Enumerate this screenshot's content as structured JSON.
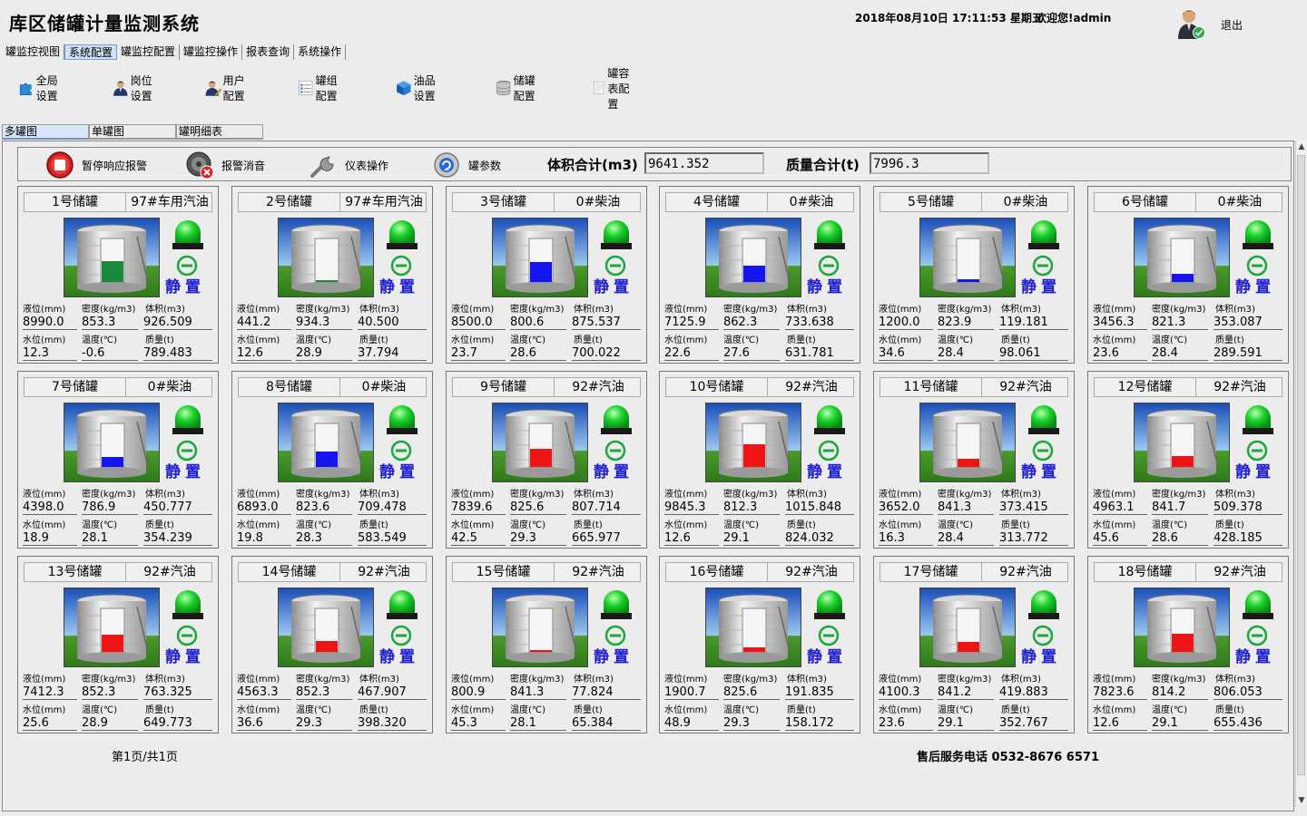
{
  "app": {
    "title": "库区储罐计量监测系统",
    "datetime": "2018年08月10日 17:11:53 星期五",
    "welcome": "欢迎您!admin",
    "logout": "退出"
  },
  "menu": [
    {
      "label": "罐监控视图",
      "active": false
    },
    {
      "label": "系统配置",
      "active": true
    },
    {
      "label": "罐监控配置",
      "active": false
    },
    {
      "label": "罐监控操作",
      "active": false
    },
    {
      "label": "报表查询",
      "active": false
    },
    {
      "label": "系统操作",
      "active": false
    }
  ],
  "toolbar": [
    {
      "label": "全局设置",
      "icon": "puzzle-icon"
    },
    {
      "label": "岗位设置",
      "icon": "person-icon"
    },
    {
      "label": "用户配置",
      "icon": "user-edit-icon"
    },
    {
      "label": "罐组配置",
      "icon": "list-icon"
    },
    {
      "label": "油品设置",
      "icon": "cube-icon"
    },
    {
      "label": "储罐配置",
      "icon": "database-icon"
    },
    {
      "label": "罐容表配置",
      "icon": "document-icon"
    }
  ],
  "view_tabs": [
    {
      "label": "多罐图",
      "active": true
    },
    {
      "label": "单罐图",
      "active": false
    },
    {
      "label": "罐明细表",
      "active": false
    }
  ],
  "actions": {
    "pause_alarm": "暂停响应报警",
    "mute_alarm": "报警消音",
    "instrument": "仪表操作",
    "tank_params": "罐参数",
    "volume_total_label": "体积合计(m3)",
    "volume_total": "9641.352",
    "mass_total_label": "质量合计(t)",
    "mass_total": "7996.3"
  },
  "labels": {
    "level": "液位(mm)",
    "density": "密度(kg/m3)",
    "volume": "体积(m3)",
    "water": "水位(mm)",
    "temperature": "温度(℃)",
    "mass": "质量(t)"
  },
  "tanks": [
    {
      "name": "1号储罐",
      "oil": "97#车用汽油",
      "state": "静置",
      "level": "8990.0",
      "density": "853.3",
      "volume": "926.509",
      "water": "12.3",
      "temperature": "-0.6",
      "mass": "789.483",
      "fill_color": "#1a8a3c",
      "fill_fraction": 0.48
    },
    {
      "name": "2号储罐",
      "oil": "97#车用汽油",
      "state": "静置",
      "level": "441.2",
      "density": "934.3",
      "volume": "40.500",
      "water": "12.6",
      "temperature": "28.9",
      "mass": "37.794",
      "fill_color": "#1a8a3c",
      "fill_fraction": 0.02
    },
    {
      "name": "3号储罐",
      "oil": "0#柴油",
      "state": "静置",
      "level": "8500.0",
      "density": "800.6",
      "volume": "875.537",
      "water": "23.7",
      "temperature": "28.6",
      "mass": "700.022",
      "fill_color": "#1515f0",
      "fill_fraction": 0.45
    },
    {
      "name": "4号储罐",
      "oil": "0#柴油",
      "state": "静置",
      "level": "7125.9",
      "density": "862.3",
      "volume": "733.638",
      "water": "22.6",
      "temperature": "27.6",
      "mass": "631.781",
      "fill_color": "#1515f0",
      "fill_fraction": 0.38
    },
    {
      "name": "5号储罐",
      "oil": "0#柴油",
      "state": "静置",
      "level": "1200.0",
      "density": "823.9",
      "volume": "119.181",
      "water": "34.6",
      "temperature": "28.4",
      "mass": "98.061",
      "fill_color": "#1515f0",
      "fill_fraction": 0.06
    },
    {
      "name": "6号储罐",
      "oil": "0#柴油",
      "state": "静置",
      "level": "3456.3",
      "density": "821.3",
      "volume": "353.087",
      "water": "23.6",
      "temperature": "28.4",
      "mass": "289.591",
      "fill_color": "#1515f0",
      "fill_fraction": 0.18
    },
    {
      "name": "7号储罐",
      "oil": "0#柴油",
      "state": "静置",
      "level": "4398.0",
      "density": "786.9",
      "volume": "450.777",
      "water": "18.9",
      "temperature": "28.1",
      "mass": "354.239",
      "fill_color": "#1515f0",
      "fill_fraction": 0.23
    },
    {
      "name": "8号储罐",
      "oil": "0#柴油",
      "state": "静置",
      "level": "6893.0",
      "density": "823.6",
      "volume": "709.478",
      "water": "19.8",
      "temperature": "28.3",
      "mass": "583.549",
      "fill_color": "#1515f0",
      "fill_fraction": 0.36
    },
    {
      "name": "9号储罐",
      "oil": "92#汽油",
      "state": "静置",
      "level": "7839.6",
      "density": "825.6",
      "volume": "807.714",
      "water": "42.5",
      "temperature": "29.3",
      "mass": "665.977",
      "fill_color": "#f01515",
      "fill_fraction": 0.42
    },
    {
      "name": "10号储罐",
      "oil": "92#汽油",
      "state": "静置",
      "level": "9845.3",
      "density": "812.3",
      "volume": "1015.848",
      "water": "12.6",
      "temperature": "29.1",
      "mass": "824.032",
      "fill_color": "#f01515",
      "fill_fraction": 0.52
    },
    {
      "name": "11号储罐",
      "oil": "92#汽油",
      "state": "静置",
      "level": "3652.0",
      "density": "841.3",
      "volume": "373.415",
      "water": "16.3",
      "temperature": "28.4",
      "mass": "313.772",
      "fill_color": "#f01515",
      "fill_fraction": 0.19
    },
    {
      "name": "12号储罐",
      "oil": "92#汽油",
      "state": "静置",
      "level": "4963.1",
      "density": "841.7",
      "volume": "509.378",
      "water": "45.6",
      "temperature": "28.6",
      "mass": "428.185",
      "fill_color": "#f01515",
      "fill_fraction": 0.26
    },
    {
      "name": "13号储罐",
      "oil": "92#汽油",
      "state": "静置",
      "level": "7412.3",
      "density": "852.3",
      "volume": "763.325",
      "water": "25.6",
      "temperature": "28.9",
      "mass": "649.773",
      "fill_color": "#f01515",
      "fill_fraction": 0.39
    },
    {
      "name": "14号储罐",
      "oil": "92#汽油",
      "state": "静置",
      "level": "4563.3",
      "density": "852.3",
      "volume": "467.907",
      "water": "36.6",
      "temperature": "29.3",
      "mass": "398.320",
      "fill_color": "#f01515",
      "fill_fraction": 0.24
    },
    {
      "name": "15号储罐",
      "oil": "92#汽油",
      "state": "静置",
      "level": "800.9",
      "density": "841.3",
      "volume": "77.824",
      "water": "45.3",
      "temperature": "28.1",
      "mass": "65.384",
      "fill_color": "#f01515",
      "fill_fraction": 0.04
    },
    {
      "name": "16号储罐",
      "oil": "92#汽油",
      "state": "静置",
      "level": "1900.7",
      "density": "825.6",
      "volume": "191.835",
      "water": "48.9",
      "temperature": "29.3",
      "mass": "158.172",
      "fill_color": "#f01515",
      "fill_fraction": 0.1
    },
    {
      "name": "17号储罐",
      "oil": "92#汽油",
      "state": "静置",
      "level": "4100.3",
      "density": "841.2",
      "volume": "419.883",
      "water": "23.6",
      "temperature": "29.1",
      "mass": "352.767",
      "fill_color": "#f01515",
      "fill_fraction": 0.22
    },
    {
      "name": "18号储罐",
      "oil": "92#汽油",
      "state": "静置",
      "level": "7823.6",
      "density": "814.2",
      "volume": "806.053",
      "water": "12.6",
      "temperature": "29.1",
      "mass": "655.436",
      "fill_color": "#f01515",
      "fill_fraction": 0.41
    }
  ],
  "footer": {
    "page_indicator": "第1页/共1页",
    "service_phone": "售后服务电话 0532-8676 6571"
  }
}
